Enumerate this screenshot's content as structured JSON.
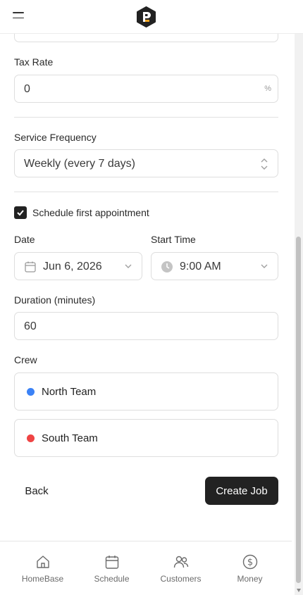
{
  "header": {
    "menu_icon": "hamburger-icon",
    "logo_icon": "p-hexagon-logo"
  },
  "form": {
    "tax_rate": {
      "label": "Tax Rate",
      "value": "0",
      "suffix": "%"
    },
    "service_frequency": {
      "label": "Service Frequency",
      "value": "Weekly (every 7 days)"
    },
    "schedule_first": {
      "label": "Schedule first appointment",
      "checked": true
    },
    "date": {
      "label": "Date",
      "value": "Jun 6, 2026",
      "icon": "calendar-icon"
    },
    "start_time": {
      "label": "Start Time",
      "value": "9:00 AM",
      "icon": "clock-icon"
    },
    "duration": {
      "label": "Duration (minutes)",
      "value": "60"
    },
    "crew": {
      "label": "Crew",
      "teams": [
        {
          "name": "North Team",
          "color": "#3b82f6"
        },
        {
          "name": "South Team",
          "color": "#ef4444"
        }
      ]
    }
  },
  "actions": {
    "back_label": "Back",
    "create_label": "Create Job"
  },
  "nav": {
    "items": [
      {
        "label": "HomeBase",
        "icon": "home-icon"
      },
      {
        "label": "Schedule",
        "icon": "calendar-icon"
      },
      {
        "label": "Customers",
        "icon": "users-icon"
      },
      {
        "label": "Money",
        "icon": "dollar-circle-icon"
      }
    ]
  }
}
